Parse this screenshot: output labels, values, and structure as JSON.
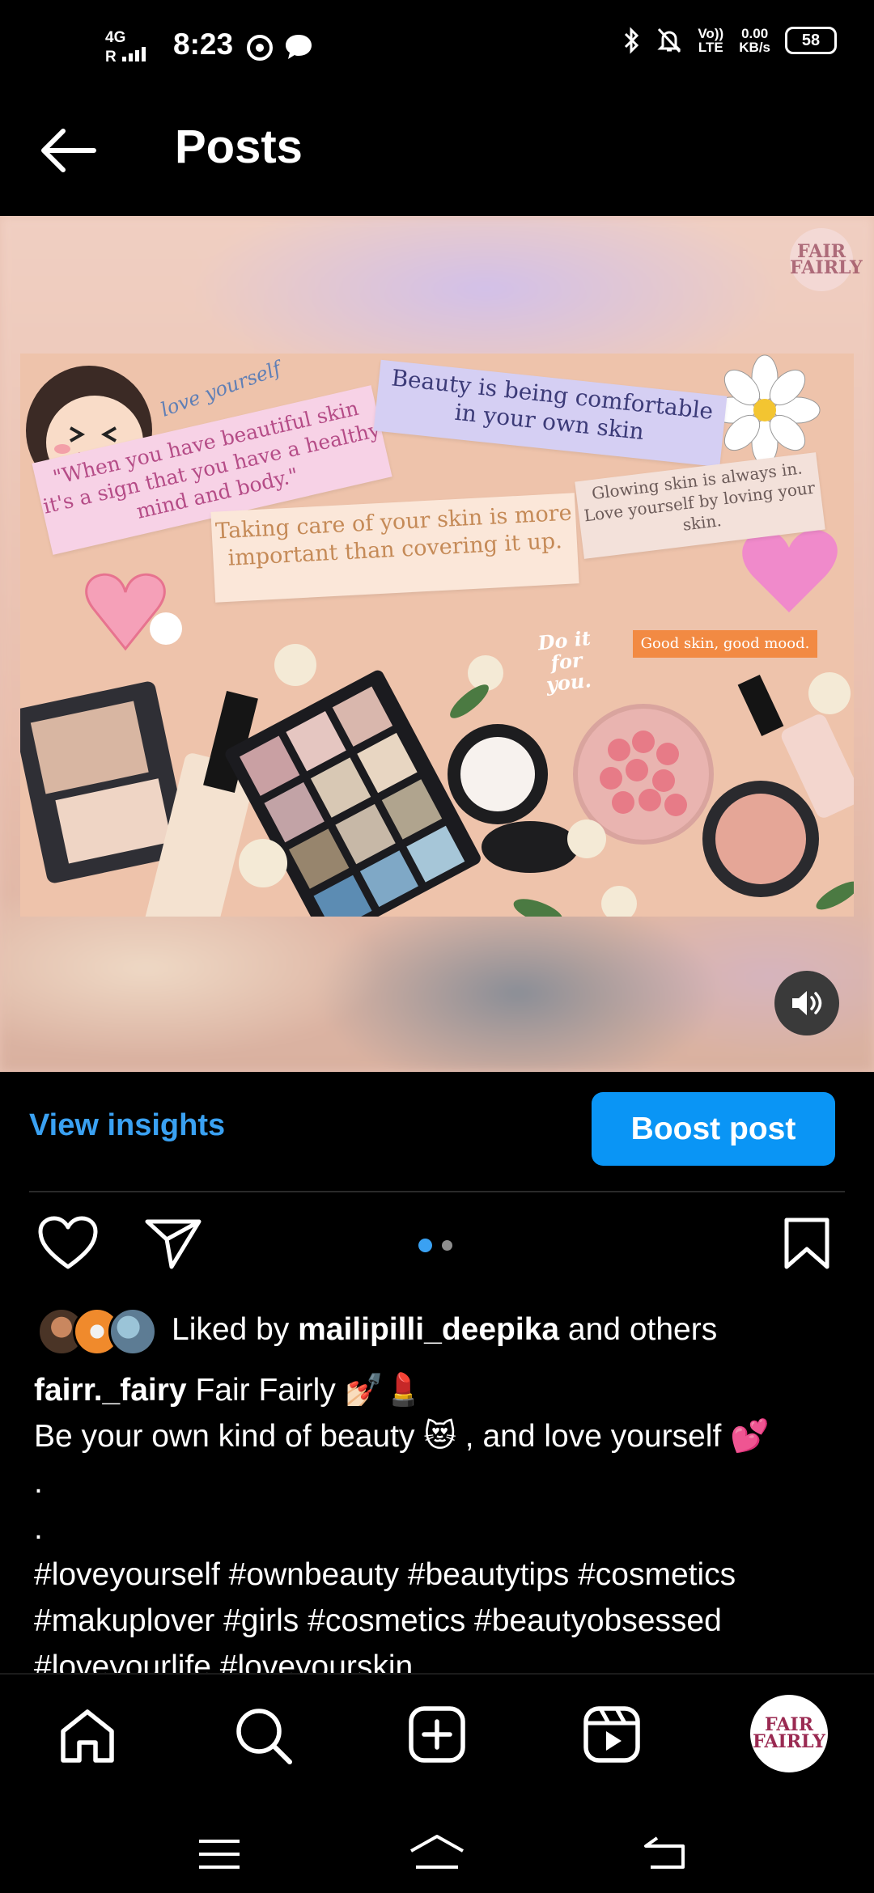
{
  "status_bar": {
    "network": "4G",
    "roaming": "R",
    "time": "8:23",
    "volte": "Vo)) LTE",
    "speed_value": "0.00",
    "speed_unit": "KB/s",
    "battery": "58"
  },
  "header": {
    "title": "Posts"
  },
  "media": {
    "watermark_line1": "FAIR",
    "watermark_line2": "FAIRLY",
    "note_script": "love yourself",
    "note_1": "\"When you have beautiful skin it's a sign that you have a healthy mind and body.\"",
    "note_2": "Beauty is being comfortable in your own skin",
    "note_3": "Taking care of your skin is more important than covering it up.",
    "note_4": "Glowing skin is always in. Love yourself by loving your skin.",
    "note_5": "Good skin, good mood.",
    "note_6": "Do it for you.",
    "carousel_count": 2,
    "carousel_active": 0
  },
  "actions": {
    "insights_label": "View insights",
    "boost_label": "Boost post"
  },
  "post": {
    "liked_prefix": "Liked by",
    "liked_user": "mailipilli_deepika",
    "liked_suffix": "and others",
    "username": "fairr._fairy",
    "caption_first": "Fair Fairly 💅🏻💄",
    "caption_line2": "Be your own kind of beauty 😻 , and love yourself 💕",
    "caption_dot1": ".",
    "caption_dot2": ".",
    "hashtags_line1": "#loveyourself #ownbeauty #beautytips #cosmetics",
    "hashtags_line2": "#makuplover #girls #cosmetics #beautyobsessed",
    "hashtags_line3": "#loveyourlife #loveyourskin"
  },
  "nav": {
    "profile_line1": "FAIR",
    "profile_line2": "FAIRLY"
  },
  "colors": {
    "accent": "#0a95f5",
    "link": "#3aa1f2",
    "background": "#000000"
  }
}
